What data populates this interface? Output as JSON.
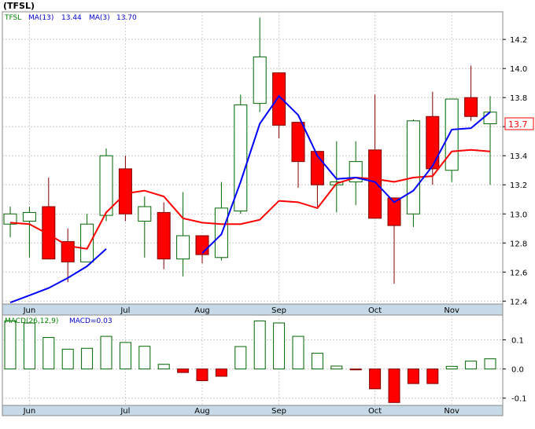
{
  "chart_data": [
    {
      "type": "candlestick",
      "title": "(TFSL)",
      "legend": {
        "ticker": "TFSL",
        "ma_long_label": "MA(13)",
        "ma_long_value": "13.44",
        "ma_short_label": "MA(3)",
        "ma_short_value": "13.70"
      },
      "last_price_label": "13.7",
      "ylim": [
        12.38,
        14.39
      ],
      "y_ticks": [
        "12.4",
        "12.6",
        "12.8",
        "13.0",
        "13.2",
        "13.4",
        "13.6",
        "13.8",
        "14.0",
        "14.2"
      ],
      "x_ticks": [
        {
          "label": "Jun",
          "index": 1
        },
        {
          "label": "Jul",
          "index": 6
        },
        {
          "label": "Aug",
          "index": 10
        },
        {
          "label": "Sep",
          "index": 14
        },
        {
          "label": "Oct",
          "index": 19
        },
        {
          "label": "Nov",
          "index": 23
        }
      ],
      "candles": [
        {
          "open": 12.93,
          "high": 13.05,
          "low": 12.84,
          "close": 13.0
        },
        {
          "open": 12.95,
          "high": 13.05,
          "low": 12.7,
          "close": 13.01
        },
        {
          "open": 13.05,
          "high": 13.25,
          "low": 12.7,
          "close": 12.69
        },
        {
          "open": 12.81,
          "high": 12.9,
          "low": 12.53,
          "close": 12.67
        },
        {
          "open": 12.67,
          "high": 13.0,
          "low": 12.67,
          "close": 12.93
        },
        {
          "open": 12.99,
          "high": 13.45,
          "low": 12.95,
          "close": 13.4
        },
        {
          "open": 13.31,
          "high": 13.4,
          "low": 12.95,
          "close": 13.0
        },
        {
          "open": 12.95,
          "high": 13.12,
          "low": 12.7,
          "close": 13.05
        },
        {
          "open": 13.01,
          "high": 13.08,
          "low": 12.62,
          "close": 12.69
        },
        {
          "open": 12.69,
          "high": 13.15,
          "low": 12.57,
          "close": 12.85
        },
        {
          "open": 12.85,
          "high": 12.85,
          "low": 12.66,
          "close": 12.72
        },
        {
          "open": 12.7,
          "high": 13.22,
          "low": 12.68,
          "close": 13.04
        },
        {
          "open": 13.02,
          "high": 13.82,
          "low": 13.0,
          "close": 13.75
        },
        {
          "open": 13.76,
          "high": 14.35,
          "low": 13.7,
          "close": 14.08
        },
        {
          "open": 13.97,
          "high": 13.97,
          "low": 13.52,
          "close": 13.61
        },
        {
          "open": 13.63,
          "high": 13.63,
          "low": 13.18,
          "close": 13.36
        },
        {
          "open": 13.43,
          "high": 13.43,
          "low": 13.05,
          "close": 13.2
        },
        {
          "open": 13.2,
          "high": 13.5,
          "low": 13.01,
          "close": 13.22
        },
        {
          "open": 13.22,
          "high": 13.5,
          "low": 13.06,
          "close": 13.36
        },
        {
          "open": 13.44,
          "high": 13.82,
          "low": 12.97,
          "close": 12.97
        },
        {
          "open": 13.11,
          "high": 13.11,
          "low": 12.52,
          "close": 12.92
        },
        {
          "open": 13.0,
          "high": 13.65,
          "low": 12.91,
          "close": 13.64
        },
        {
          "open": 13.67,
          "high": 13.84,
          "low": 13.2,
          "close": 13.31
        },
        {
          "open": 13.3,
          "high": 13.79,
          "low": 13.22,
          "close": 13.79
        },
        {
          "open": 13.8,
          "high": 14.02,
          "low": 13.64,
          "close": 13.67
        },
        {
          "open": 13.62,
          "high": 13.81,
          "low": 13.2,
          "close": 13.7
        }
      ],
      "ma_short": [
        {
          "index": 10,
          "value": 12.73
        },
        {
          "index": 11,
          "value": 12.86
        },
        {
          "index": 12,
          "value": 13.22
        },
        {
          "index": 13,
          "value": 13.62
        },
        {
          "index": 14,
          "value": 13.81
        },
        {
          "index": 15,
          "value": 13.68
        },
        {
          "index": 16,
          "value": 13.4
        },
        {
          "index": 17,
          "value": 13.24
        },
        {
          "index": 18,
          "value": 13.25
        },
        {
          "index": 19,
          "value": 13.22
        },
        {
          "index": 20,
          "value": 13.08
        },
        {
          "index": 21,
          "value": 13.16
        },
        {
          "index": 22,
          "value": 13.33
        },
        {
          "index": 23,
          "value": 13.58
        },
        {
          "index": 24,
          "value": 13.59
        },
        {
          "index": 25,
          "value": 13.7
        }
      ],
      "ma_long": [
        {
          "index": 0,
          "value": 12.94
        },
        {
          "index": 1,
          "value": 12.93
        },
        {
          "index": 2,
          "value": 12.86
        },
        {
          "index": 3,
          "value": 12.78
        },
        {
          "index": 4,
          "value": 12.76
        },
        {
          "index": 5,
          "value": 13.01
        },
        {
          "index": 6,
          "value": 13.14
        },
        {
          "index": 7,
          "value": 13.16
        },
        {
          "index": 8,
          "value": 13.12
        },
        {
          "index": 9,
          "value": 12.97
        },
        {
          "index": 10,
          "value": 12.94
        },
        {
          "index": 11,
          "value": 12.93
        },
        {
          "index": 12,
          "value": 12.93
        },
        {
          "index": 13,
          "value": 12.96
        },
        {
          "index": 14,
          "value": 13.09
        },
        {
          "index": 15,
          "value": 13.08
        },
        {
          "index": 16,
          "value": 13.04
        },
        {
          "index": 17,
          "value": 13.21
        },
        {
          "index": 18,
          "value": 13.25
        },
        {
          "index": 19,
          "value": 13.24
        },
        {
          "index": 20,
          "value": 13.22
        },
        {
          "index": 21,
          "value": 13.25
        },
        {
          "index": 22,
          "value": 13.26
        },
        {
          "index": 23,
          "value": 13.43
        },
        {
          "index": 24,
          "value": 13.44
        },
        {
          "index": 25,
          "value": 13.43
        }
      ],
      "ma_long_early": [
        {
          "index": 0,
          "value": 12.39
        },
        {
          "index": 1,
          "value": 12.44
        },
        {
          "index": 2,
          "value": 12.49
        },
        {
          "index": 3,
          "value": 12.56
        },
        {
          "index": 4,
          "value": 12.64
        },
        {
          "index": 5,
          "value": 12.76
        }
      ]
    },
    {
      "type": "bar",
      "title": "MACD(26,12,9)",
      "value_label": "MACD=0.03",
      "ylim": [
        -0.125,
        0.185
      ],
      "y_ticks": [
        "0.1",
        "0.0",
        "-0.1"
      ],
      "values": [
        0.165,
        0.158,
        0.108,
        0.068,
        0.071,
        0.112,
        0.091,
        0.078,
        0.016,
        -0.012,
        -0.04,
        -0.025,
        0.077,
        0.165,
        0.158,
        0.112,
        0.054,
        0.01,
        -0.003,
        -0.068,
        -0.115,
        -0.05,
        -0.05,
        0.009,
        0.027,
        0.035
      ]
    }
  ]
}
